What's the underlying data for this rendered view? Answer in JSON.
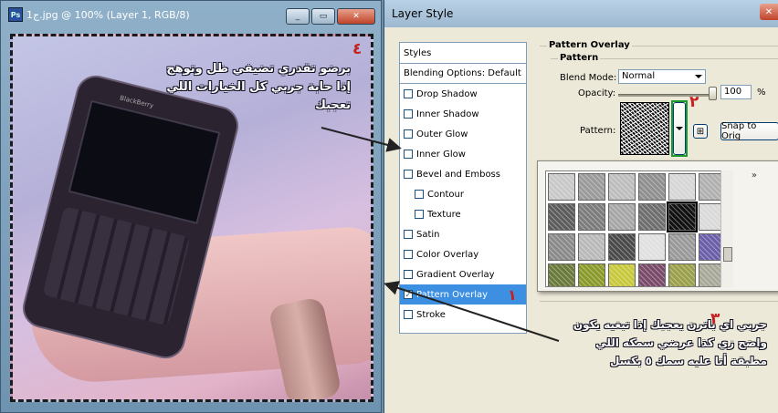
{
  "document": {
    "title": "ج1‎.jpg @ 100% (Layer 1, RGB/8)",
    "app_icon": "Ps",
    "buttons": {
      "minimize": "_",
      "maximize": "▭",
      "close": "✕"
    },
    "phone_brand": "BlackBerry",
    "overlay_text_1": "برضو تقدري تضيفي ظل وتوهج إذا حابة جربي كل الخيارات اللي تعجبك",
    "overlay_text_2": "جربي اي باترن يعجبك إذا تبغيه يكون واضح زي كذا عرضي سمكه اللي مطبقة أنا عليه سمك ٥ بكسل",
    "step_4": "٤",
    "step_3": "٣",
    "step_2": "٢",
    "step_1": "١"
  },
  "dialog": {
    "title": "Layer Style",
    "close": "✕",
    "styles_header": "Styles",
    "blending": "Blending Options: Default",
    "items": [
      {
        "label": "Drop Shadow",
        "checked": false
      },
      {
        "label": "Inner Shadow",
        "checked": false
      },
      {
        "label": "Outer Glow",
        "checked": false
      },
      {
        "label": "Inner Glow",
        "checked": false
      },
      {
        "label": "Bevel and Emboss",
        "checked": false
      },
      {
        "label": "Contour",
        "checked": false
      },
      {
        "label": "Texture",
        "checked": false
      },
      {
        "label": "Satin",
        "checked": false
      },
      {
        "label": "Color Overlay",
        "checked": false
      },
      {
        "label": "Gradient Overlay",
        "checked": false
      },
      {
        "label": "Pattern Overlay",
        "checked": true
      },
      {
        "label": "Stroke",
        "checked": false
      }
    ],
    "group_title": "Pattern Overlay",
    "sub_title": "Pattern",
    "blend_mode_label": "Blend Mode:",
    "blend_mode_value": "Normal",
    "opacity_label": "Opacity:",
    "opacity_value": "100",
    "opacity_unit": "%",
    "opacity_level": 1.0,
    "pattern_label": "Pattern:",
    "snap_button": "Snap to Orig",
    "menu_arrow": "»"
  },
  "pattern_tiles": [
    "#c8c8c8",
    "#9a9a9a",
    "#bdbdbd",
    "#8f8f8f",
    "#d6d6d6",
    "#b0b0b0",
    "#5c5c5c",
    "#7c7c7c",
    "#a6a6a6",
    "#6e6e6e",
    "#111111",
    "#d9d9d9",
    "#8a8a8a",
    "#b9b9b9",
    "#4a4a4a",
    "#e0e0e0",
    "#999999",
    "#6a5fa8",
    "#6a7a3a",
    "#8a9a2a",
    "#c8c83c",
    "#7a4a6a",
    "#9aa04a",
    "#a8a898"
  ]
}
